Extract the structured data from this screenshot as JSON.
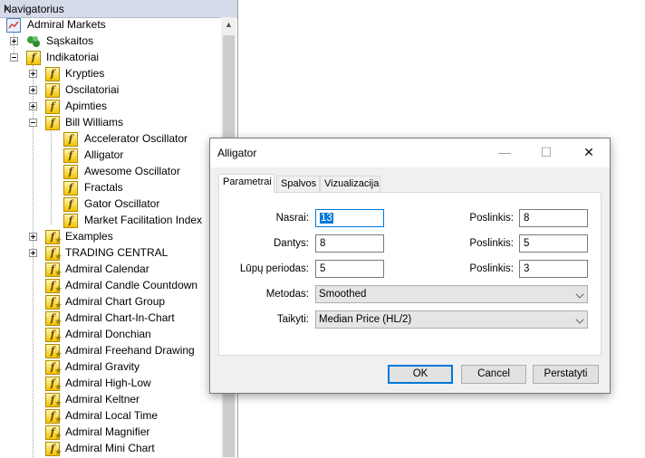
{
  "navigator": {
    "title": "Navigatorius",
    "close": "×",
    "root": "Admiral Markets",
    "accounts": "Sąskaitos",
    "indicators": "Indikatoriai",
    "groups": [
      {
        "label": "Krypties",
        "expanded": false
      },
      {
        "label": "Oscilatoriai",
        "expanded": false
      },
      {
        "label": "Apimties",
        "expanded": false
      },
      {
        "label": "Bill Williams",
        "expanded": true
      }
    ],
    "bill_williams_items": [
      "Accelerator Oscillator",
      "Alligator",
      "Awesome Oscillator",
      "Fractals",
      "Gator Oscillator",
      "Market Facilitation Index"
    ],
    "examples": "Examples",
    "trading_central": "TRADING CENTRAL",
    "custom_items": [
      "Admiral Calendar",
      "Admiral Candle Countdown",
      "Admiral Chart Group",
      "Admiral Chart-In-Chart",
      "Admiral Donchian",
      "Admiral Freehand Drawing",
      "Admiral Gravity",
      "Admiral High-Low",
      "Admiral Keltner",
      "Admiral Local Time",
      "Admiral Magnifier",
      "Admiral Mini Chart"
    ]
  },
  "dialog": {
    "title": "Alligator",
    "minimize": "—",
    "maximize": "☐",
    "close": "✕",
    "tabs": [
      "Parametrai",
      "Spalvos",
      "Vizualizacija"
    ],
    "active_tab": "Parametrai",
    "params": [
      {
        "label": "Nasrai:",
        "value": "13",
        "shift_label": "Poslinkis:",
        "shift": "8"
      },
      {
        "label": "Dantys:",
        "value": "8",
        "shift_label": "Poslinkis:",
        "shift": "5"
      },
      {
        "label": "Lūpų periodas:",
        "value": "5",
        "shift_label": "Poslinkis:",
        "shift": "3"
      }
    ],
    "method_label": "Metodas:",
    "method_value": "Smoothed",
    "apply_label": "Taikyti:",
    "apply_value": "Median Price (HL/2)",
    "ok": "OK",
    "cancel": "Cancel",
    "reset": "Perstatyti"
  },
  "colors": {
    "accent": "#0078d7",
    "folder_icon": "#f2c400",
    "nav_title_bg": "#d6dbe9"
  },
  "icons": {
    "root": "terminal-icon",
    "accounts": "accounts-icon",
    "folder": "f-function-icon",
    "custom": "f-star-function-icon"
  }
}
